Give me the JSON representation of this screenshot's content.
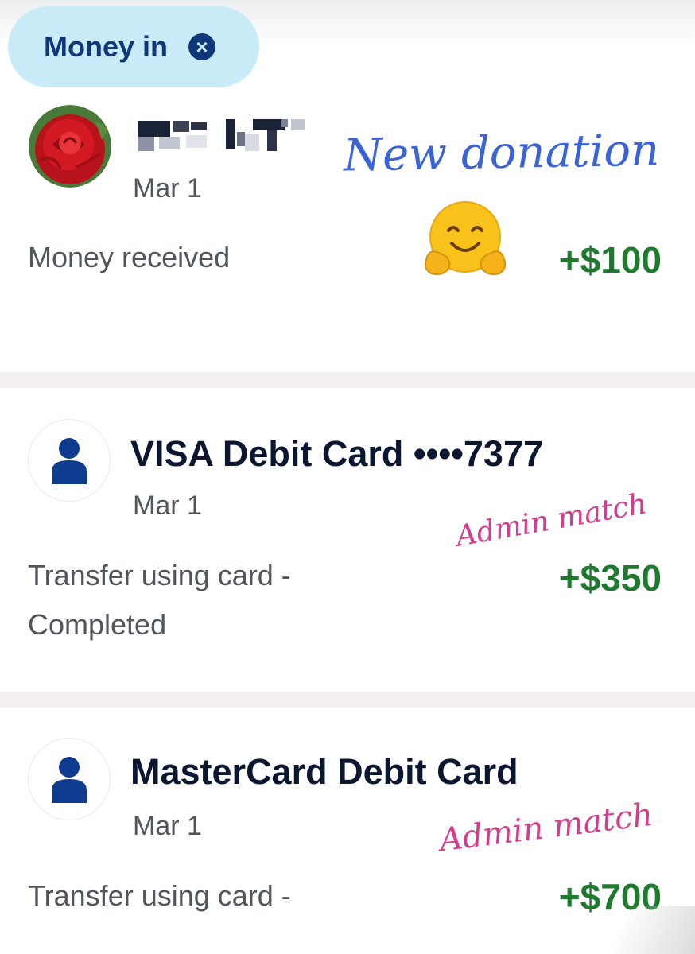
{
  "filter_chip": {
    "label": "Money in",
    "clear_icon": "close-circle-icon"
  },
  "transactions": [
    {
      "avatar": "rose-photo",
      "name_redacted": true,
      "date": "Mar 1",
      "description": "Money received",
      "amount": "+$100",
      "annotation": "New donation",
      "emoji": "hugging-face-emoji"
    },
    {
      "avatar": "person-icon",
      "title": "VISA Debit Card ••••7377",
      "date": "Mar 1",
      "description_line1": "Transfer using card -",
      "description_line2": "Completed",
      "amount": "+$350",
      "annotation": "Admin match"
    },
    {
      "avatar": "person-icon",
      "title": "MasterCard Debit Card",
      "date": "Mar 1",
      "description_line1": "Transfer using card -",
      "amount": "+$700",
      "annotation": "Admin match"
    }
  ],
  "colors": {
    "chip_bg": "#c9ebf7",
    "chip_text": "#10377a",
    "amount_green": "#1f7a2f",
    "annotation_blue": "#3a63d8",
    "annotation_pink": "#d33d8d",
    "icon_navy": "#0f3b8f"
  }
}
